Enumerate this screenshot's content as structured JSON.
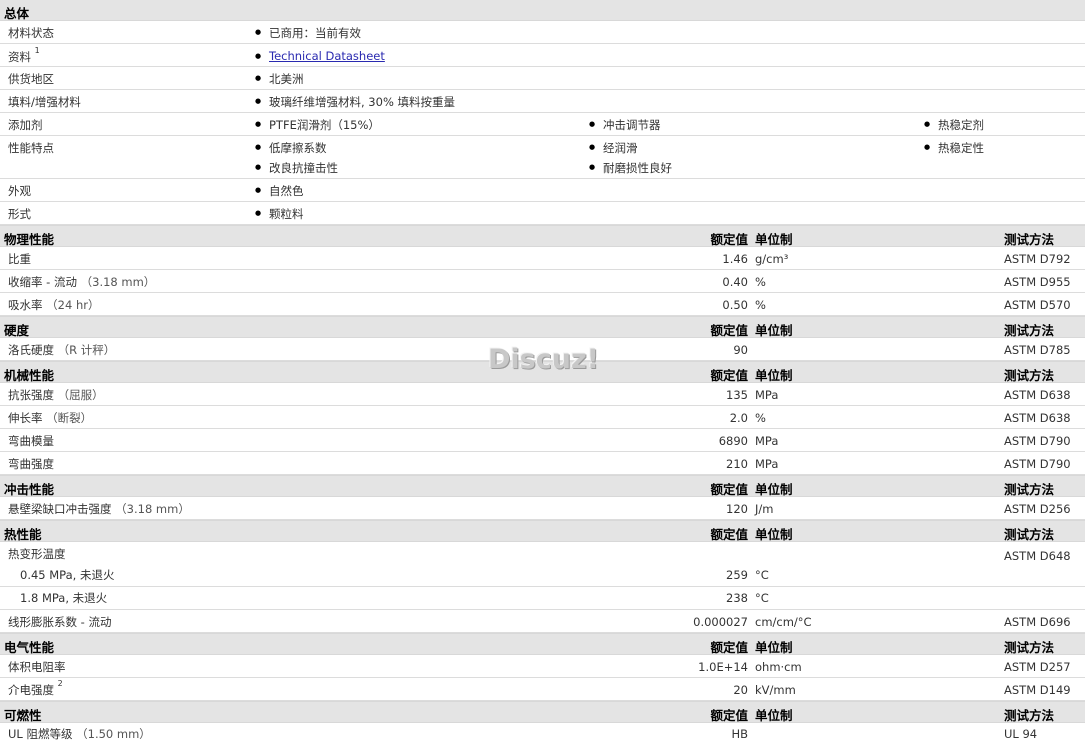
{
  "general": {
    "title": "总体",
    "rows": [
      {
        "label": "材料状态",
        "items": [
          "已商用：当前有效"
        ]
      },
      {
        "label": "资料",
        "sup": "1",
        "link": "Technical Datasheet"
      },
      {
        "label": "供货地区",
        "items": [
          "北美洲"
        ]
      },
      {
        "label": "填料/增强材料",
        "items": [
          "玻璃纤维增强材料, 30% 填料按重量"
        ]
      },
      {
        "label": "添加剂",
        "items": [
          "PTFE润滑剂（15%）",
          "冲击调节器",
          "热稳定剂"
        ]
      },
      {
        "label": "性能特点",
        "items": [
          "低摩擦系数",
          "经润滑",
          "热稳定性",
          "改良抗撞击性",
          "耐磨损性良好"
        ]
      },
      {
        "label": "外观",
        "items": [
          "自然色"
        ]
      },
      {
        "label": "形式",
        "items": [
          "颗粒料"
        ]
      }
    ]
  },
  "headers": {
    "value": "额定值",
    "unit": "单位制",
    "method": "测试方法"
  },
  "sections": {
    "physical": {
      "title": "物理性能",
      "rows": [
        {
          "label": "比重",
          "value": "1.46",
          "unit": "g/cm³",
          "method": "ASTM D792"
        },
        {
          "label": "收缩率",
          "suffix": "- 流动",
          "cond": "（3.18 mm）",
          "value": "0.40",
          "unit": "%",
          "method": "ASTM D955"
        },
        {
          "label": "吸水率",
          "cond": "（24 hr）",
          "value": "0.50",
          "unit": "%",
          "method": "ASTM D570"
        }
      ]
    },
    "hardness": {
      "title": "硬度",
      "rows": [
        {
          "label": "洛氏硬度",
          "cond": "（R 计秤）",
          "value": "90",
          "unit": "",
          "method": "ASTM D785"
        }
      ]
    },
    "mechanical": {
      "title": "机械性能",
      "rows": [
        {
          "label": "抗张强度",
          "cond": "（屈服）",
          "value": "135",
          "unit": "MPa",
          "method": "ASTM D638"
        },
        {
          "label": "伸长率",
          "cond": "（断裂）",
          "value": "2.0",
          "unit": "%",
          "method": "ASTM D638"
        },
        {
          "label": "弯曲模量",
          "value": "6890",
          "unit": "MPa",
          "method": "ASTM D790"
        },
        {
          "label": "弯曲强度",
          "value": "210",
          "unit": "MPa",
          "method": "ASTM D790"
        }
      ]
    },
    "impact": {
      "title": "冲击性能",
      "rows": [
        {
          "label": "悬壁梁缺口冲击强度",
          "cond": "（3.18 mm）",
          "value": "120",
          "unit": "J/m",
          "method": "ASTM D256"
        }
      ]
    },
    "thermal": {
      "title": "热性能",
      "rows": [
        {
          "label": "热变形温度",
          "method": "ASTM D648"
        },
        {
          "label": "0.45 MPa, 未退火",
          "value": "259",
          "unit": "°C"
        },
        {
          "label": "1.8 MPa, 未退火",
          "value": "238",
          "unit": "°C"
        },
        {
          "label": "线形膨胀系数",
          "suffix": "- 流动",
          "value": "0.000027",
          "unit": "cm/cm/°C",
          "method": "ASTM D696"
        }
      ]
    },
    "electrical": {
      "title": "电气性能",
      "rows": [
        {
          "label": "体积电阻率",
          "value": "1.0E+14",
          "unit": "ohm·cm",
          "method": "ASTM D257"
        },
        {
          "label": "介电强度",
          "sup": "2",
          "value": "20",
          "unit": "kV/mm",
          "method": "ASTM D149"
        }
      ]
    },
    "flammability": {
      "title": "可燃性",
      "rows": [
        {
          "label": "UL 阻燃等级",
          "cond": "（1.50 mm）",
          "value": "HB",
          "unit": "",
          "method": "UL 94"
        }
      ]
    }
  },
  "watermark": "Discuz!"
}
